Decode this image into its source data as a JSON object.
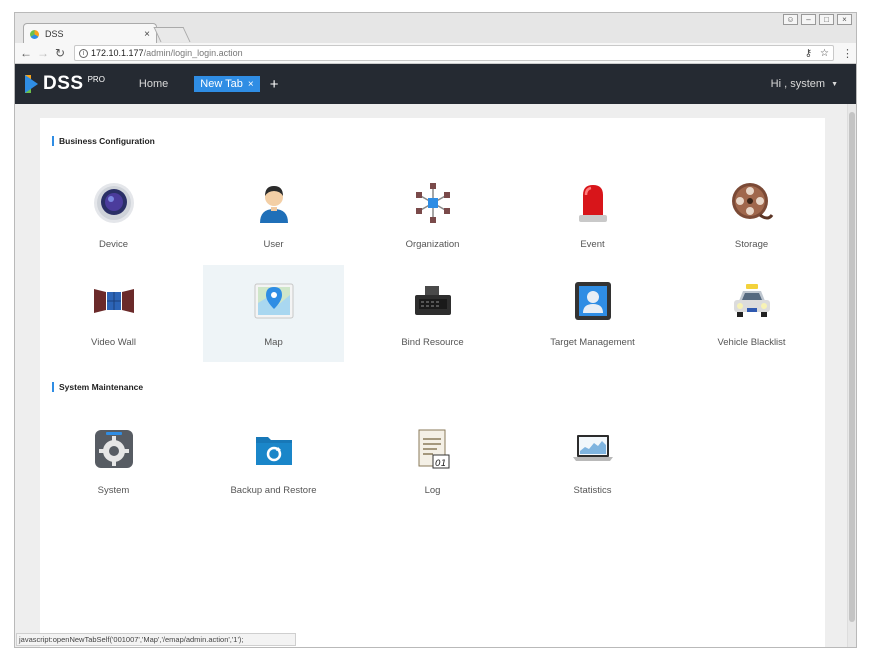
{
  "browser": {
    "tab_title": "DSS",
    "tab_close": "×",
    "url_host": "172.10.1.177",
    "url_path": "/admin/login_login.action",
    "status_text": "javascript:openNewTabSelf('001007','Map','/emap/admin.action','1');"
  },
  "header": {
    "logo_text": "DSS",
    "logo_sup": "PRO",
    "home_label": "Home",
    "active_tab_label": "New Tab",
    "active_tab_close": "×",
    "add_tab": "+",
    "user_greeting": "Hi , system"
  },
  "sections": {
    "business": {
      "title": "Business Configuration",
      "items": [
        {
          "label": "Device",
          "icon": "camera-icon"
        },
        {
          "label": "User",
          "icon": "user-icon"
        },
        {
          "label": "Organization",
          "icon": "organization-icon"
        },
        {
          "label": "Event",
          "icon": "alarm-light-icon"
        },
        {
          "label": "Storage",
          "icon": "film-reel-icon"
        },
        {
          "label": "Video Wall",
          "icon": "video-wall-icon"
        },
        {
          "label": "Map",
          "icon": "map-pin-icon"
        },
        {
          "label": "Bind Resource",
          "icon": "nvr-device-icon"
        },
        {
          "label": "Target Management",
          "icon": "face-target-icon"
        },
        {
          "label": "Vehicle Blacklist",
          "icon": "taxi-car-icon"
        }
      ]
    },
    "maintenance": {
      "title": "System Maintenance",
      "items": [
        {
          "label": "System",
          "icon": "gear-icon"
        },
        {
          "label": "Backup and Restore",
          "icon": "backup-folder-icon"
        },
        {
          "label": "Log",
          "icon": "log-document-icon"
        },
        {
          "label": "Statistics",
          "icon": "laptop-chart-icon"
        }
      ]
    }
  },
  "colors": {
    "header_bg": "#252a32",
    "accent": "#2f8de4",
    "hover_tile": "#eef4f7"
  }
}
